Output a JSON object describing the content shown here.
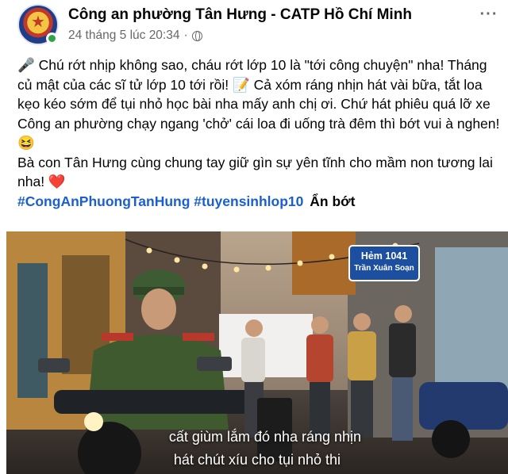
{
  "post": {
    "page_name": "Công an phường Tân Hưng - CATP Hồ Chí Minh",
    "timestamp": "24 tháng 5 lúc 20:34",
    "separator": "·",
    "more_label": "···",
    "paragraph_1": "🎤 Chú rớt nhịp không sao, cháu rớt lớp 10 là \"tới công chuyện\" nha! Tháng củ mật của các sĩ tử lớp 10 tới rồi! 📝 Cả xóm ráng nhịn hát vài bữa, tắt loa kẹo kéo sớm để tụi nhỏ học bài nha mấy anh chị ơi. Chứ hát phiêu quá lỡ xe Công an phường chạy ngang 'chở' cái loa đi uống trà đêm thì bớt vui à nghen! 😆",
    "paragraph_2": "Bà con Tân Hưng cùng chung tay giữ gìn sự yên tĩnh cho mầm non tương lai nha! ❤️",
    "hashtag_1": "#CongAnPhuongTanHung",
    "hashtag_2": "#tuyensinhlop10",
    "see_less": "Ẩn bớt"
  },
  "photo": {
    "street_sign_line1": "Hẻm 1041",
    "street_sign_line2": "Trần Xuân Soạn",
    "subtitle_line1": "cất giùm lắm đó nha ráng nhịn",
    "subtitle_line2": "hát chút xíu cho tụi nhỏ thi"
  },
  "colors": {
    "hashtag": "#1b5fcf",
    "meta_text": "#65676b",
    "online": "#31a24c"
  }
}
